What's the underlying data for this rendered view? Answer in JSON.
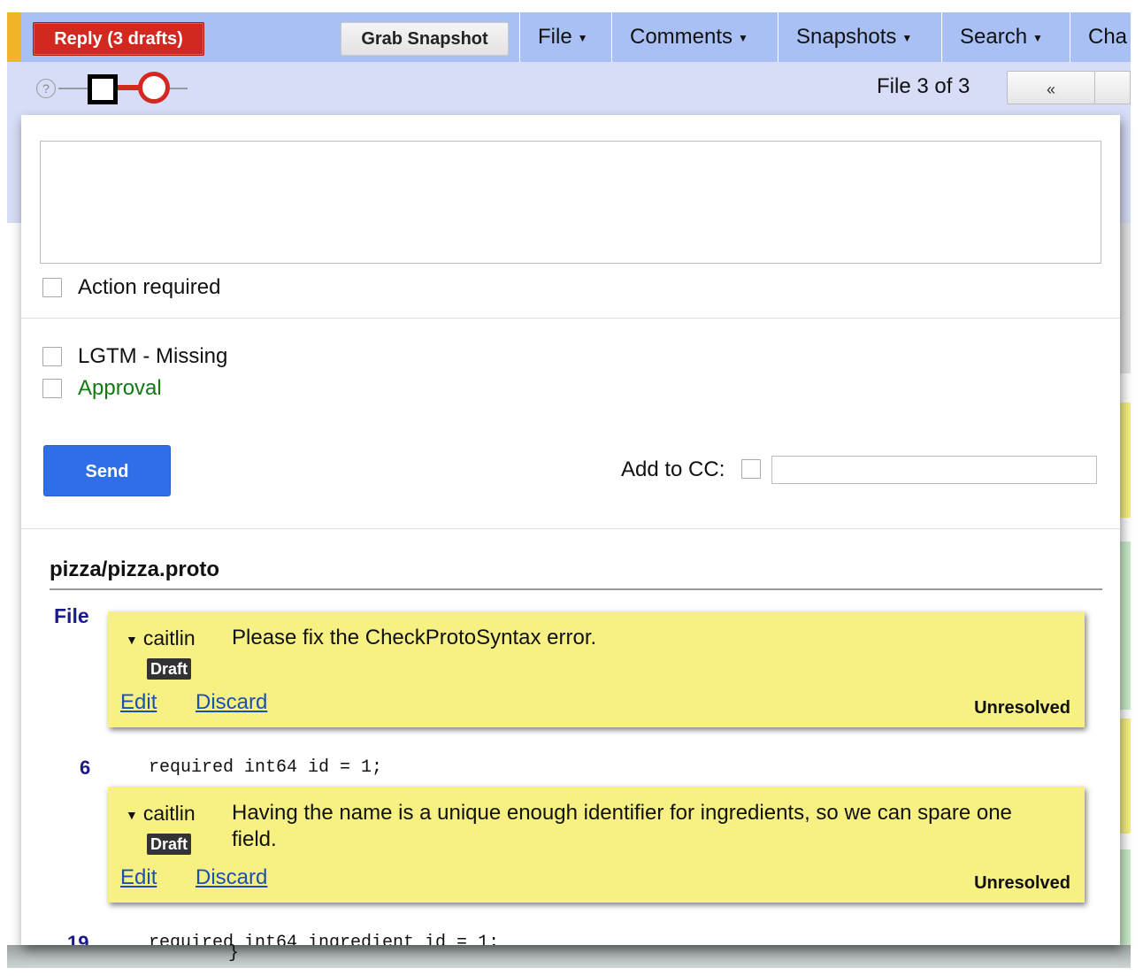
{
  "toolbar": {
    "reply_label": "Reply (3 drafts)",
    "grab_snapshot_label": "Grab Snapshot",
    "menus": [
      {
        "label": "File"
      },
      {
        "label": "Comments"
      },
      {
        "label": "Snapshots"
      },
      {
        "label": "Search"
      },
      {
        "label": "Cha"
      }
    ]
  },
  "subbar": {
    "help_symbol": "?",
    "file_count": "File 3 of 3",
    "prev_label": "«"
  },
  "reply_panel": {
    "message_value": "",
    "action_required_label": "Action required",
    "lgtm_label": "LGTM - Missing",
    "approval_label": "Approval",
    "send_label": "Send",
    "add_to_cc_label": "Add to CC:",
    "cc_value": ""
  },
  "file_view": {
    "path": "pizza/pizza.proto",
    "file_label": "File",
    "lines": [
      {
        "num": "6",
        "code": "  required int64 id = 1;"
      },
      {
        "num": "19",
        "code": "  required int64 ingredient_id = 1;"
      }
    ],
    "stray_brace": "}",
    "comments": [
      {
        "author": "caitlin",
        "text": "Please fix the CheckProtoSyntax error.",
        "badge": "Draft",
        "edit_label": "Edit",
        "discard_label": "Discard",
        "status": "Unresolved"
      },
      {
        "author": "caitlin",
        "text": "Having the name is a unique enough identifier for ingredients, so we can spare one field.",
        "badge": "Draft",
        "edit_label": "Edit",
        "discard_label": "Discard",
        "status": "Unresolved"
      }
    ]
  },
  "colors": {
    "toolbar_bg": "#a9c0f5",
    "subbar_bg": "#d7ddf7",
    "reply_red": "#d3281f",
    "send_blue": "#2f6ee6",
    "comment_yellow": "#f7f183",
    "approval_green": "#117a11",
    "link_blue": "#1b4fb8"
  }
}
